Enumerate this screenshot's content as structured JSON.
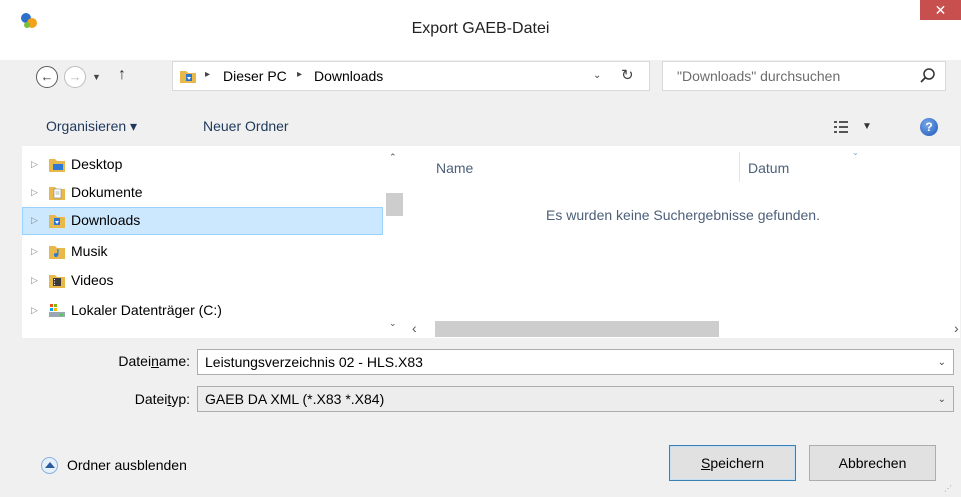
{
  "window": {
    "title": "Export GAEB-Datei",
    "close_glyph": "✕",
    "icon": "app-icon"
  },
  "nav": {
    "back_glyph": "←",
    "forward_glyph": "→",
    "recent_glyph": "▼",
    "up_glyph": "↑"
  },
  "address": {
    "sep_glyph": "▸",
    "crumbs": [
      "Dieser PC",
      "Downloads"
    ],
    "drop_glyph": "⌄",
    "refresh_glyph": "↻"
  },
  "search": {
    "placeholder": "\"Downloads\" durchsuchen"
  },
  "toolbar": {
    "organize_label": "Organisieren ▾",
    "new_folder_label": "Neuer Ordner",
    "view_drop_glyph": "▼",
    "help_glyph": "?"
  },
  "tree": {
    "expander_glyph": "▷",
    "items": [
      {
        "label": "Desktop",
        "icon": "desktop-folder-icon",
        "selected": false
      },
      {
        "label": "Dokumente",
        "icon": "documents-folder-icon",
        "selected": false
      },
      {
        "label": "Downloads",
        "icon": "downloads-folder-icon",
        "selected": true
      },
      {
        "label": "Musik",
        "icon": "music-folder-icon",
        "selected": false
      },
      {
        "label": "Videos",
        "icon": "videos-folder-icon",
        "selected": false
      },
      {
        "label": "Lokaler Datenträger (C:)",
        "icon": "local-disk-icon",
        "selected": false
      }
    ],
    "scroll_up_glyph": "⌃",
    "scroll_down_glyph": "⌄"
  },
  "list": {
    "columns": [
      "Name",
      "Datum"
    ],
    "sort_glyph": "⌄",
    "empty_message": "Es wurden keine Suchergebnisse gefunden.",
    "scroll_left_glyph": "‹",
    "scroll_right_glyph": "›"
  },
  "form": {
    "filename_label_pre": "Datei",
    "filename_label_u": "n",
    "filename_label_post": "ame:",
    "filename_value": "Leistungsverzeichnis 02 - HLS.X83",
    "filetype_label_pre": "Datei",
    "filetype_label_u": "t",
    "filetype_label_post": "yp:",
    "filetype_value": "GAEB DA XML (*.X83 *.X84)",
    "combo_arrow_glyph": "⌄"
  },
  "footer": {
    "hide_folders_label": "Ordner ausblenden",
    "save_label_u": "S",
    "save_label_rest": "peichern",
    "cancel_label": "Abbrechen",
    "grip_glyph": "⋰"
  },
  "colors": {
    "close_red": "#c7504f",
    "selection_bg": "#cce8ff",
    "selection_border": "#99d1ff",
    "link_blue": "#1e395b",
    "muted_header": "#4c607a"
  }
}
